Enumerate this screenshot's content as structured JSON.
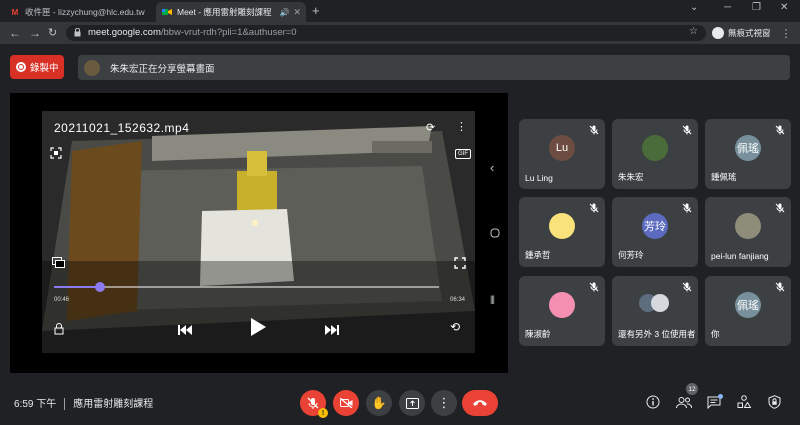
{
  "browser": {
    "tabs": [
      {
        "label": "收件匣 - lizzychung@hlc.edu.tw",
        "favicon": "gmail-icon",
        "active": false
      },
      {
        "label": "Meet - 應用雷射雕刻課程",
        "favicon": "meet-icon",
        "active": true
      }
    ],
    "address": {
      "host": "meet.google.com",
      "path": "/bbw-vrut-rdh?pli=1&authuser=0"
    },
    "profile_label": "無痕式視窗",
    "window_controls": [
      "─",
      "❐",
      "✕"
    ]
  },
  "meeting": {
    "recording_label": "錄製中",
    "presenter_notice": "朱朱宏正在分享螢幕畫面",
    "time": "6:59 下午",
    "title": "應用雷射雕刻課程",
    "participant_count": "12",
    "mic_badge": "!"
  },
  "shared_video": {
    "filename": "20211021_152632.mp4",
    "elapsed": "00:46",
    "duration": "06:34",
    "progress": 0.12,
    "gif_label": "GIF"
  },
  "participants": [
    {
      "name": "Lu Ling",
      "initials": "Lu",
      "avatar_color": "#6d4c41"
    },
    {
      "name": "朱朱宏",
      "initials": "",
      "avatar_color": "#4a6b3a"
    },
    {
      "name": "鍾佩瑤",
      "initials": "佩瑤",
      "avatar_color": "#78909c"
    },
    {
      "name": "鍾承哲",
      "initials": "",
      "avatar_color": "#f9e27a"
    },
    {
      "name": "何芳玲",
      "initials": "芳玲",
      "avatar_color": "#5c6bc0"
    },
    {
      "name": "pei-lun fanjiang",
      "initials": "",
      "avatar_color": "#8d8d7a"
    },
    {
      "name": "陳淑齡",
      "initials": "",
      "avatar_color": "#f48fb1"
    },
    {
      "name": "還有另外 3 位使用者",
      "initials": "",
      "avatar_color": "#9e9e9e"
    },
    {
      "name": "你",
      "initials": "佩瑤",
      "avatar_color": "#78909c"
    }
  ]
}
